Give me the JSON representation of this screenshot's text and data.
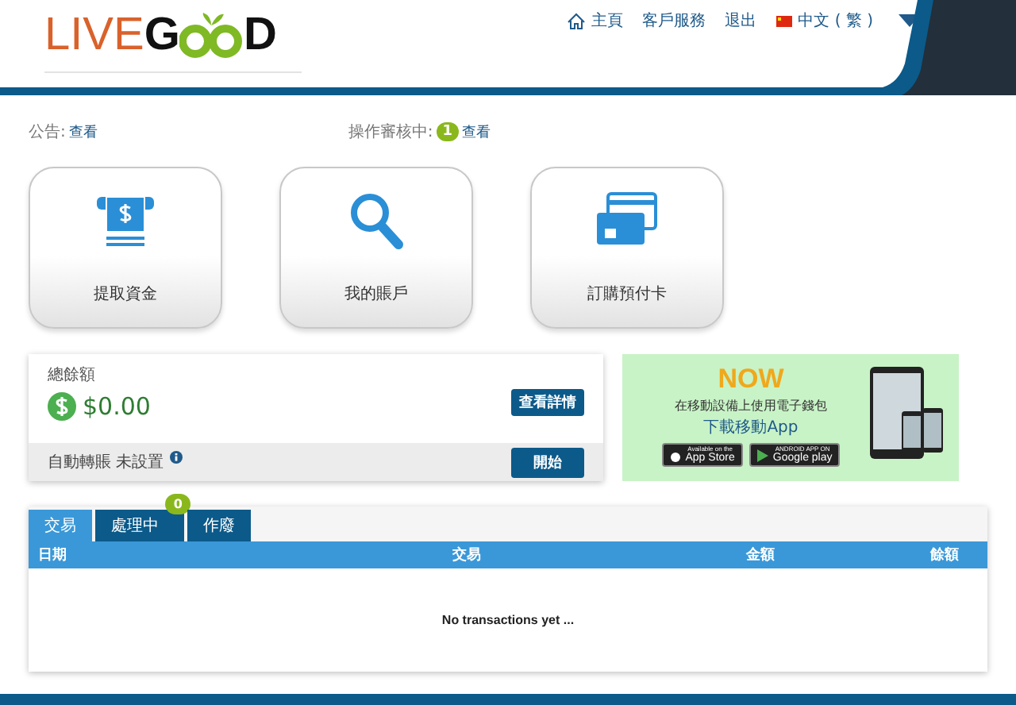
{
  "logo": {
    "parts": [
      "LIVE",
      "G",
      "D"
    ]
  },
  "nav": [
    {
      "kind": "home",
      "label": "主頁"
    },
    {
      "kind": "link",
      "label": "客戶服務"
    },
    {
      "kind": "link",
      "label": "退出"
    },
    {
      "kind": "lang",
      "label": "中文 ( 繁 )"
    }
  ],
  "notice": {
    "label": "公告:",
    "link": "查看"
  },
  "review": {
    "label": "操作審核中:",
    "count": "1",
    "link": "查看"
  },
  "tiles": [
    {
      "kind": "atm",
      "label": "提取資金"
    },
    {
      "kind": "search",
      "label": "我的賬戶"
    },
    {
      "kind": "card",
      "label": "訂購預付卡"
    }
  ],
  "balance": {
    "title": "總餘額",
    "amount": "$0.00",
    "details_button": "查看詳情",
    "auto_label": "自動轉賬 未設置",
    "start_button": "開始"
  },
  "promo": {
    "brand": "NOW",
    "line1": "在移動設備上使用電子錢包",
    "line2": "下載移動App",
    "app_store_small": "Available on the",
    "app_store": "App Store",
    "google_small": "ANDROID APP ON",
    "google": "Google play"
  },
  "tabs": [
    {
      "label": "交易",
      "selected": true
    },
    {
      "label": "處理中",
      "selected": false,
      "badge": "0"
    },
    {
      "label": "作廢",
      "selected": false
    }
  ],
  "table": {
    "columns": [
      "日期",
      "交易",
      "金額",
      "餘額"
    ],
    "empty": "No transactions yet ..."
  }
}
